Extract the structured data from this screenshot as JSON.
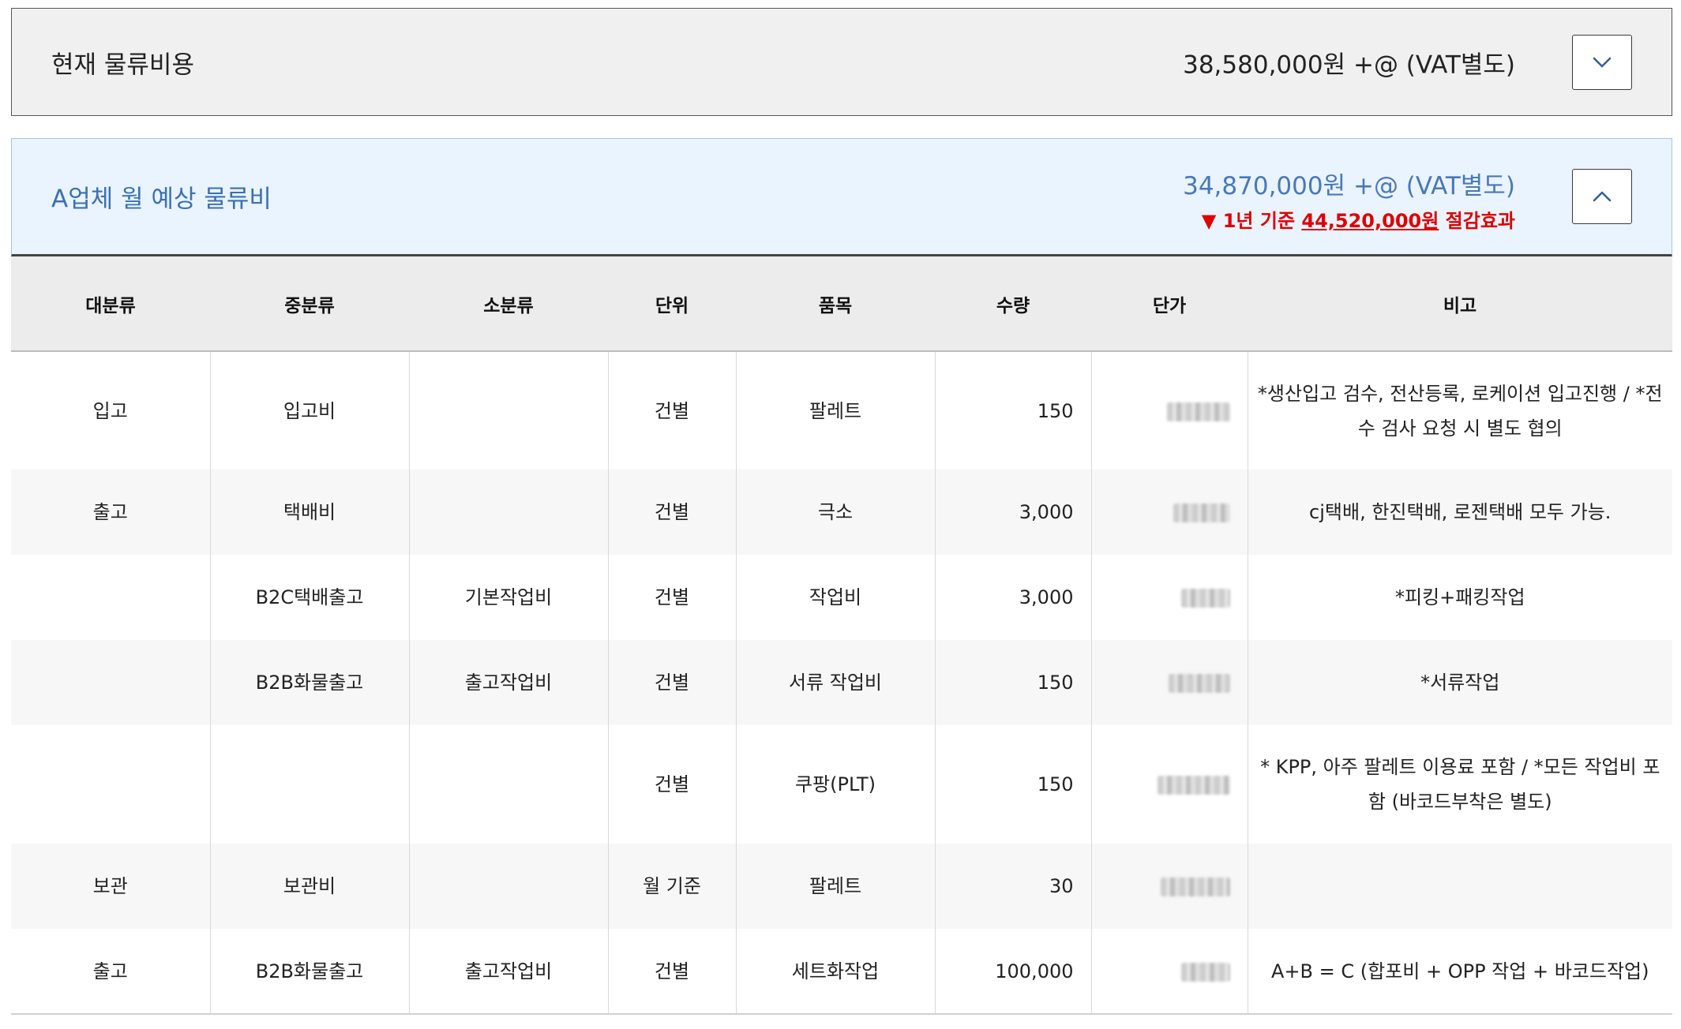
{
  "current": {
    "title": "현재 물류비용",
    "amount": "38,580,000원 +@ (VAT별도)",
    "toggle_icon": "chevron-down-icon"
  },
  "vendor": {
    "title": "A업체 월 예상 물류비",
    "amount": "34,870,000원 +@ (VAT별도)",
    "saving_prefix": "▼ 1년 기준 ",
    "saving_amount": "44,520,000원",
    "saving_suffix": " 절감효과",
    "toggle_icon": "chevron-up-icon",
    "saving_color": "#e00000",
    "title_color": "#3c6fb5"
  },
  "table": {
    "headers": [
      "대분류",
      "중분류",
      "소분류",
      "단위",
      "품목",
      "수량",
      "단가",
      "비고"
    ],
    "rows": [
      {
        "major": "입고",
        "mid": "입고비",
        "minor": "",
        "unit": "건별",
        "item": "팔레트",
        "qty": "150",
        "price_hidden": true,
        "note": "*생산입고 검수, 전산등록, 로케이션 입고진행 / *전수 검사 요청 시 별도 협의"
      },
      {
        "major": "출고",
        "mid": "택배비",
        "minor": "",
        "unit": "건별",
        "item": "극소",
        "qty": "3,000",
        "price_hidden": true,
        "note": "cj택배, 한진택배, 로젠택배 모두 가능."
      },
      {
        "major": "",
        "mid": "B2C택배출고",
        "minor": "기본작업비",
        "unit": "건별",
        "item": "작업비",
        "qty": "3,000",
        "price_hidden": true,
        "note": "*피킹+패킹작업"
      },
      {
        "major": "",
        "mid": "B2B화물출고",
        "minor": "출고작업비",
        "unit": "건별",
        "item": "서류 작업비",
        "qty": "150",
        "price_hidden": true,
        "note": "*서류작업"
      },
      {
        "major": "",
        "mid": "",
        "minor": "",
        "unit": "건별",
        "item": "쿠팡(PLT)",
        "qty": "150",
        "price_hidden": true,
        "note": "* KPP, 아주 팔레트 이용료 포함 / *모든 작업비 포함 (바코드부착은 별도)"
      },
      {
        "major": "보관",
        "mid": "보관비",
        "minor": "",
        "unit": "월 기준",
        "item": "팔레트",
        "qty": "30",
        "price_hidden": true,
        "note": ""
      },
      {
        "major": "출고",
        "mid": "B2B화물출고",
        "minor": "출고작업비",
        "unit": "건별",
        "item": "세트화작업",
        "qty": "100,000",
        "price_hidden": true,
        "note": "A+B = C (합포비 + OPP 작업 + 바코드작업)"
      }
    ]
  }
}
